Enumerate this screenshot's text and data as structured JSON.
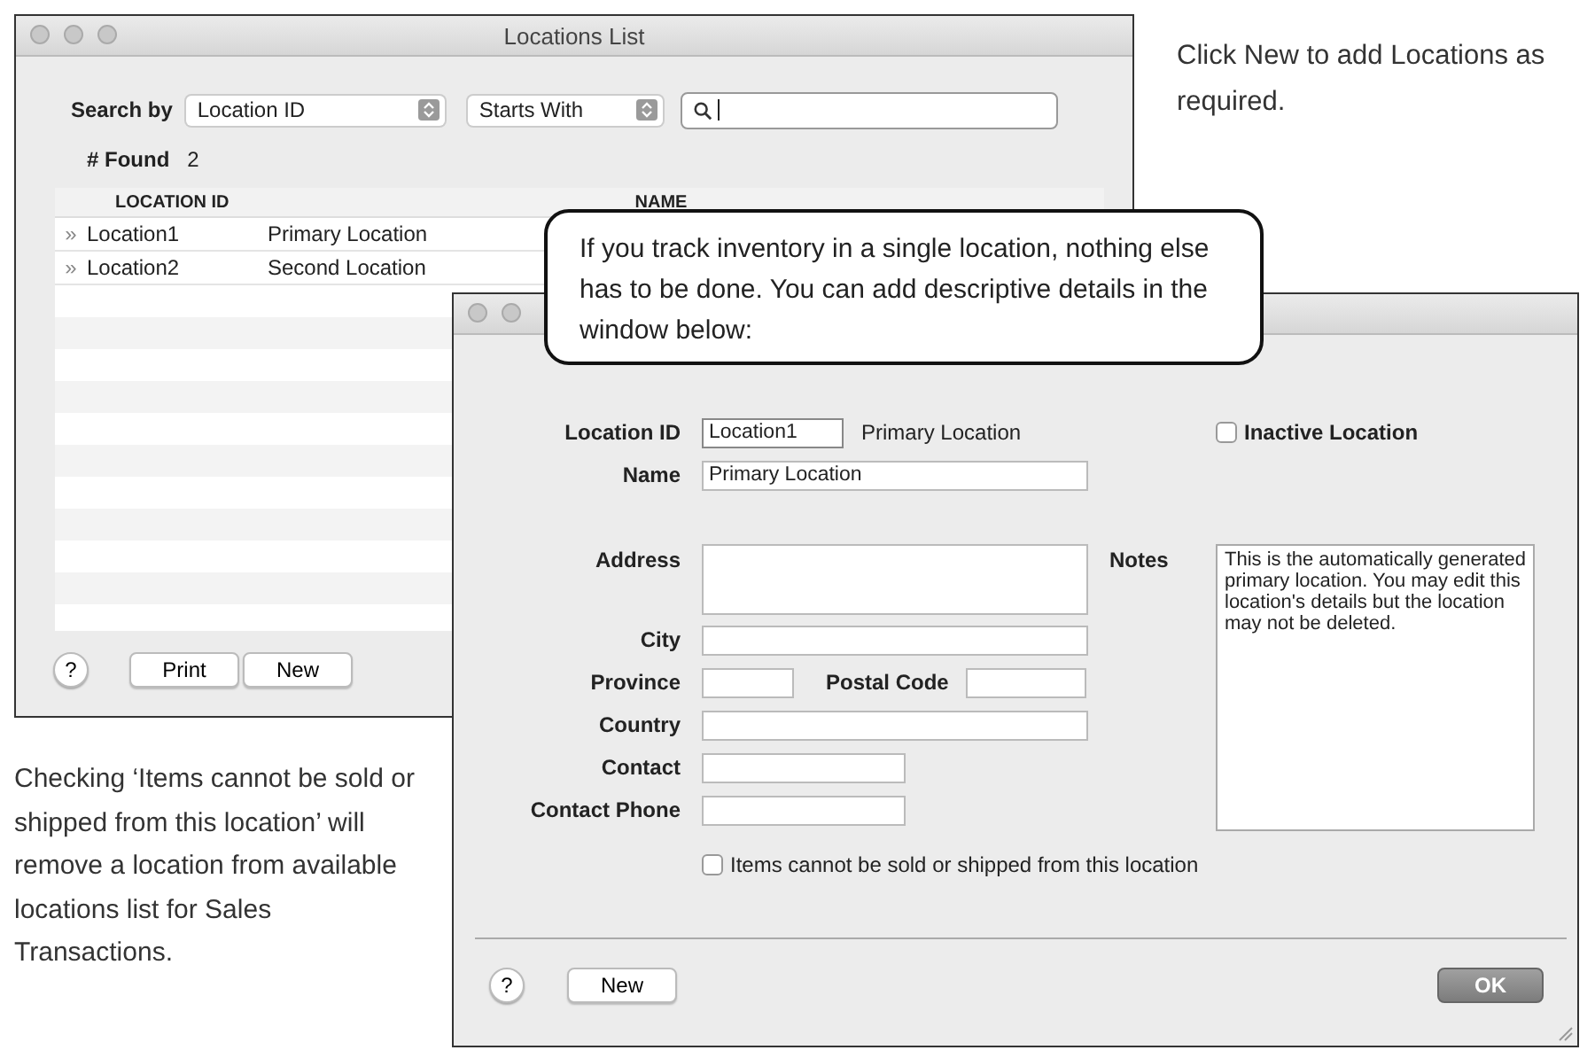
{
  "locations_list": {
    "title": "Locations List",
    "search_by_label": "Search by",
    "search_by": "Location ID",
    "match": "Starts With",
    "found_label": "# Found",
    "found": "2",
    "columns": [
      "LOCATION ID",
      "NAME"
    ],
    "rows": [
      {
        "marker": "»",
        "location_id": "Location1",
        "name": "Primary Location"
      },
      {
        "marker": "»",
        "location_id": "Location2",
        "name": "Second Location"
      }
    ],
    "help": "?",
    "buttons": [
      "Print",
      "New"
    ]
  },
  "location_window": {
    "location_id": {
      "label": "Location ID",
      "value": "Location1"
    },
    "id_name": "Primary Location",
    "inactive": {
      "label": "Inactive Location",
      "checked": false
    },
    "name": {
      "label": "Name",
      "value": "Primary Location"
    },
    "address": {
      "label": "Address"
    },
    "city": {
      "label": "City"
    },
    "province": {
      "label": "Province"
    },
    "postal_code": {
      "label": "Postal Code"
    },
    "country": {
      "label": "Country"
    },
    "contact": {
      "label": "Contact"
    },
    "contact_phone": {
      "label": "Contact Phone"
    },
    "notes": {
      "label": "Notes",
      "value": "This is the automatically generated primary location. You may edit this location's details but the location may not be deleted."
    },
    "no_sales": {
      "label": "Items cannot be sold or shipped from this location",
      "checked": false
    },
    "help": "?",
    "new": "New",
    "ok": "OK"
  },
  "callout": "If you track inventory in a single location, nothing else has to be done. You can add descriptive details in the window below:",
  "caption_right": "Click New to add Locations as required.",
  "caption_left": "Checking  ‘Items cannot be sold or shipped from this location’ will remove a location from available locations list for Sales Transactions."
}
